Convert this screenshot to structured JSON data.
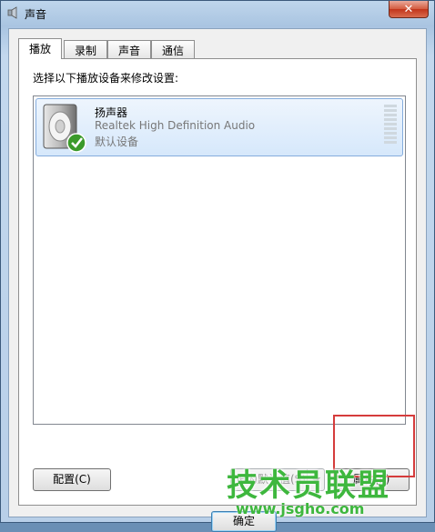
{
  "window": {
    "title": "声音",
    "close_label": "✕"
  },
  "tabs": [
    {
      "label": "播放",
      "active": true
    },
    {
      "label": "录制",
      "active": false
    },
    {
      "label": "声音",
      "active": false
    },
    {
      "label": "通信",
      "active": false
    }
  ],
  "panel": {
    "instruction": "选择以下播放设备来修改设置:",
    "device": {
      "name": "扬声器",
      "description": "Realtek High Definition Audio",
      "status": "默认设备",
      "icon": "speaker-icon",
      "status_icon": "check-icon"
    },
    "buttons": {
      "configure": "配置(C)",
      "set_default": "设为默认值(S)",
      "properties": "属性(P)"
    }
  },
  "dialog_buttons": {
    "ok": "确定"
  },
  "watermark": {
    "text": "技术员联盟",
    "url": "www.jsgho.com"
  },
  "colors": {
    "highlight": "#d53c3c",
    "watermark": "#3eb73e",
    "selection_border": "#84acdd"
  }
}
